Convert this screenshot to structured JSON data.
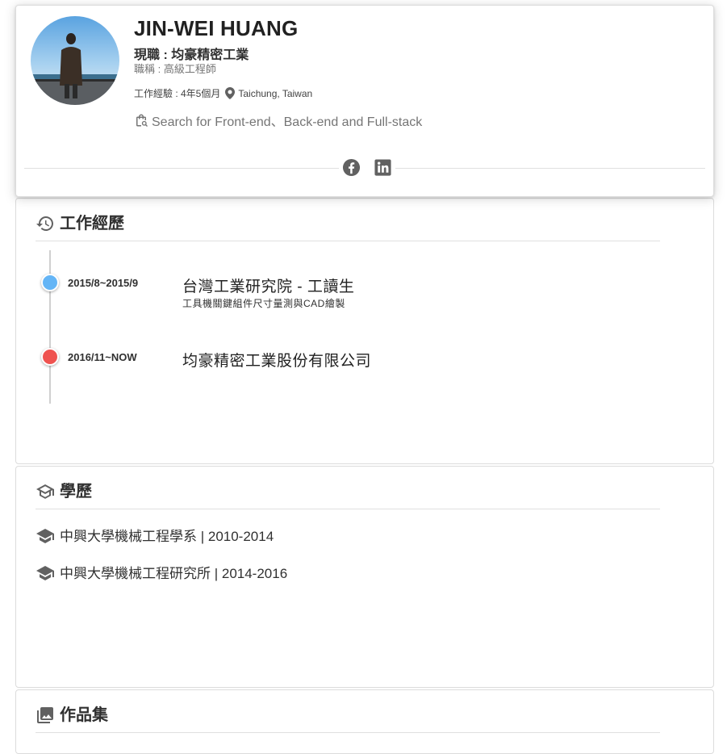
{
  "profile": {
    "name": "JIN-WEI HUANG",
    "current_job": "現職 : 均豪精密工業",
    "job_title": "職稱 : 高級工程師",
    "experience": "工作經驗 : 4年5個月",
    "location": "Taichung, Taiwan",
    "search": "Search for Front-end、Back-end and Full-stack",
    "social": [
      {
        "name": "facebook",
        "icon": "facebook-icon"
      },
      {
        "name": "linkedin",
        "icon": "linkedin-icon"
      }
    ]
  },
  "work": {
    "title": "工作經歷",
    "icon": "history-icon",
    "items": [
      {
        "date": "2015/8~2015/9",
        "company": "台灣工業研究院 - 工讀生",
        "description": "工具機關鍵組件尺寸量測與CAD繪製",
        "dot_color": "#64B5F6"
      },
      {
        "date": "2016/11~NOW",
        "company": "均豪精密工業股份有限公司",
        "description": "",
        "dot_color": "#EF5350"
      }
    ]
  },
  "education": {
    "title": "學歷",
    "icon": "school-outline-icon",
    "items": [
      {
        "label": "中興大學機械工程學系 | 2010-2014",
        "icon": "graduation-cap-icon"
      },
      {
        "label": "中興大學機械工程研究所 | 2014-2016",
        "icon": "graduation-cap-icon"
      }
    ]
  },
  "portfolio": {
    "title": "作品集",
    "icon": "photo-library-icon"
  },
  "colors": {
    "icon_gray": "#757575",
    "divider": "#e0e0e0"
  }
}
